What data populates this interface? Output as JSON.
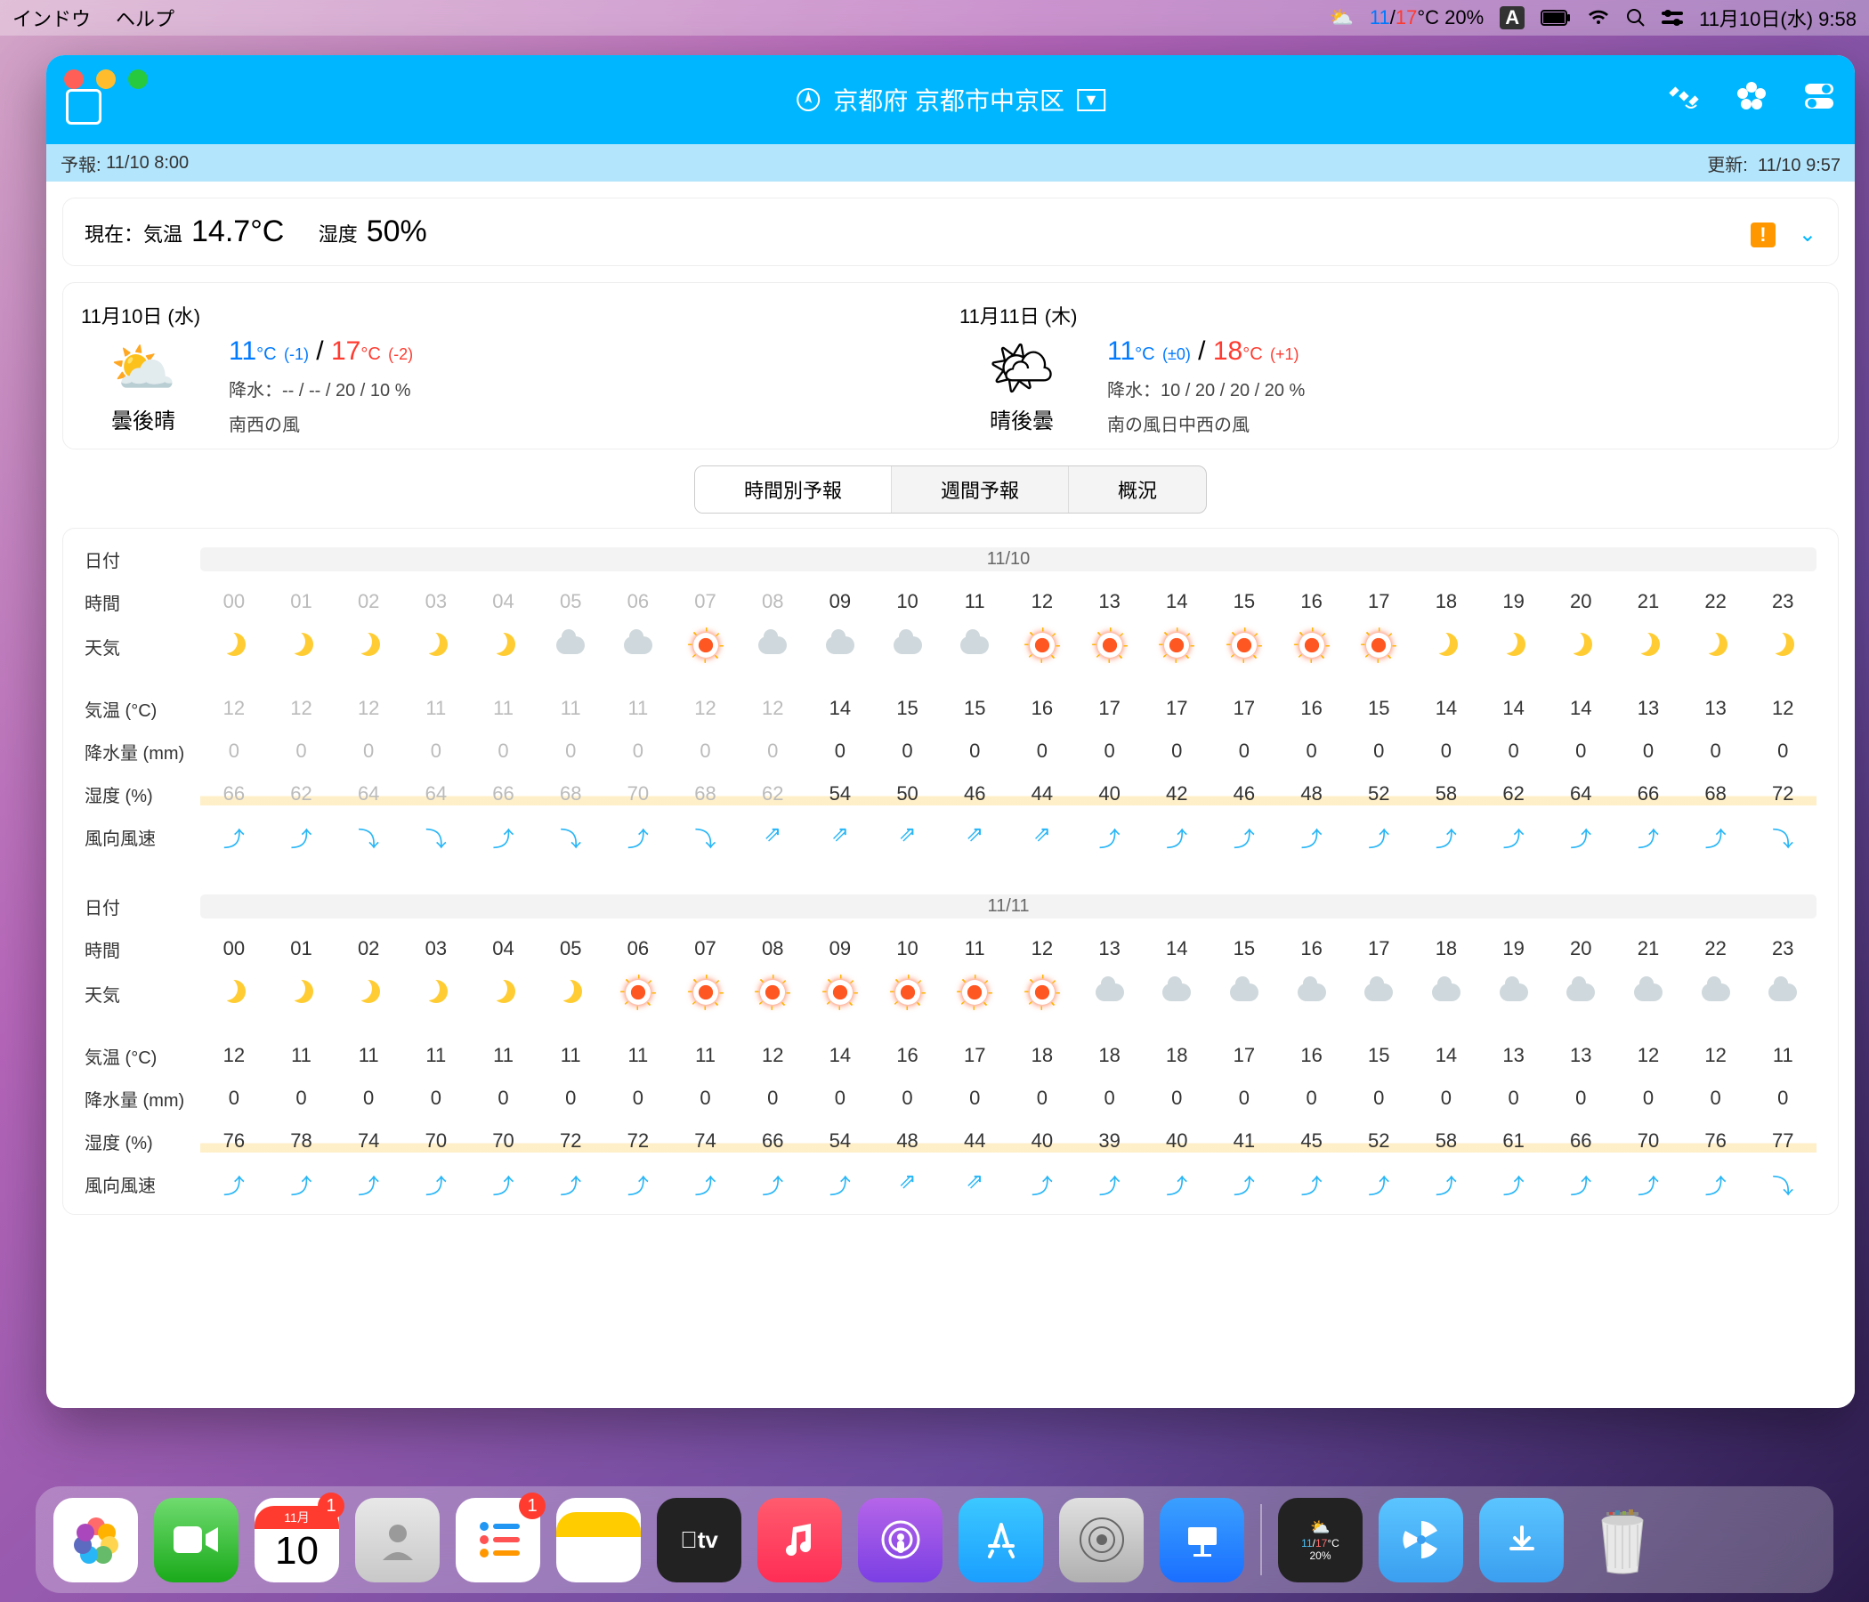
{
  "menubar": {
    "left": [
      "インドウ",
      "ヘルプ"
    ],
    "weather": {
      "lo": "11",
      "hi": "17",
      "unit": "°C",
      "pop": "20%"
    },
    "datetime": "11月10日(水)  9:58",
    "input_indicator": "A"
  },
  "titlebar": {
    "location": "京都府 京都市中京区"
  },
  "infobar": {
    "forecast_label": "予報:",
    "forecast_time": "11/10 8:00",
    "update_label": "更新:",
    "update_time": "11/10 9:57"
  },
  "now": {
    "label": "現在：気温",
    "temp": "14.7°C",
    "humidity_label": "湿度",
    "humidity": "50%"
  },
  "days": [
    {
      "title": "11月10日 (水)",
      "icon_text": "曇後晴",
      "lo": "11",
      "lo_unit": "°C",
      "lo_diff": "(-1)",
      "hi": "17",
      "hi_unit": "°C",
      "hi_diff": "(-2)",
      "precip_label": "降水：",
      "precip": "-- / -- / 20 / 10 %",
      "wind": "南西の風"
    },
    {
      "title": "11月11日 (木)",
      "icon_text": "晴後曇",
      "lo": "11",
      "lo_unit": "°C",
      "lo_diff": "(±0)",
      "hi": "18",
      "hi_unit": "°C",
      "hi_diff": "(+1)",
      "precip_label": "降水：",
      "precip": "10 / 20 / 20 / 20 %",
      "wind": "南の風日中西の風"
    }
  ],
  "tabs": {
    "hourly": "時間別予報",
    "weekly": "週間予報",
    "overview": "概況"
  },
  "labels": {
    "date": "日付",
    "time": "時間",
    "weather": "天気",
    "temp": "気温 (°C)",
    "precip": "降水量 (mm)",
    "humidity": "湿度 (%)",
    "wind": "風向風速"
  },
  "hourly": [
    {
      "date": "11/10",
      "hours": [
        "00",
        "01",
        "02",
        "03",
        "04",
        "05",
        "06",
        "07",
        "08",
        "09",
        "10",
        "11",
        "12",
        "13",
        "14",
        "15",
        "16",
        "17",
        "18",
        "19",
        "20",
        "21",
        "22",
        "23"
      ],
      "past": 9,
      "icons": [
        "moon",
        "moon",
        "moon",
        "moon",
        "moon",
        "cloud",
        "cloud",
        "sunred",
        "cloud",
        "cloud",
        "cloud",
        "cloud",
        "sunred",
        "sunred",
        "sunred",
        "sunred",
        "sunred",
        "sunred",
        "moon",
        "moon",
        "moon",
        "moon",
        "moon",
        "moon"
      ],
      "temp": [
        "12",
        "12",
        "12",
        "11",
        "11",
        "11",
        "11",
        "12",
        "12",
        "14",
        "15",
        "15",
        "16",
        "17",
        "17",
        "17",
        "16",
        "15",
        "14",
        "14",
        "14",
        "13",
        "13",
        "12"
      ],
      "precip": [
        "0",
        "0",
        "0",
        "0",
        "0",
        "0",
        "0",
        "0",
        "0",
        "0",
        "0",
        "0",
        "0",
        "0",
        "0",
        "0",
        "0",
        "0",
        "0",
        "0",
        "0",
        "0",
        "0",
        "0"
      ],
      "humidity": [
        "66",
        "62",
        "64",
        "64",
        "66",
        "68",
        "70",
        "68",
        "62",
        "54",
        "50",
        "46",
        "44",
        "40",
        "42",
        "46",
        "48",
        "52",
        "58",
        "62",
        "64",
        "66",
        "68",
        "72"
      ],
      "wind": [
        "⤴",
        "⤴",
        "⤵",
        "⤵",
        "⤴",
        "⤵",
        "⤴",
        "⤵",
        "⇗",
        "⇗",
        "⇗",
        "⇗",
        "⇗",
        "⤴",
        "⤴",
        "⤴",
        "⤴",
        "⤴",
        "⤴",
        "⤴",
        "⤴",
        "⤴",
        "⤴",
        "⤵"
      ]
    },
    {
      "date": "11/11",
      "hours": [
        "00",
        "01",
        "02",
        "03",
        "04",
        "05",
        "06",
        "07",
        "08",
        "09",
        "10",
        "11",
        "12",
        "13",
        "14",
        "15",
        "16",
        "17",
        "18",
        "19",
        "20",
        "21",
        "22",
        "23"
      ],
      "past": 0,
      "icons": [
        "moon",
        "moon",
        "moon",
        "moon",
        "moon",
        "moon",
        "sunred",
        "sunred",
        "sunred",
        "sunred",
        "sunred",
        "sunred",
        "sunred",
        "cloud",
        "cloud",
        "cloud",
        "cloud",
        "cloud",
        "cloud",
        "cloud",
        "cloud",
        "cloud",
        "cloud",
        "cloud"
      ],
      "temp": [
        "12",
        "11",
        "11",
        "11",
        "11",
        "11",
        "11",
        "11",
        "12",
        "14",
        "16",
        "17",
        "18",
        "18",
        "17",
        "16",
        "15",
        "14",
        "13",
        "13",
        "12",
        "12",
        "11"
      ],
      "temp24": [
        "12",
        "11",
        "11",
        "11",
        "11",
        "11",
        "11",
        "11",
        "12",
        "14",
        "16",
        "17",
        "18",
        "18",
        "18",
        "17",
        "16",
        "15",
        "14",
        "13",
        "13",
        "12",
        "12",
        "11"
      ],
      "precip": [
        "0",
        "0",
        "0",
        "0",
        "0",
        "0",
        "0",
        "0",
        "0",
        "0",
        "0",
        "0",
        "0",
        "0",
        "0",
        "0",
        "0",
        "0",
        "0",
        "0",
        "0",
        "0",
        "0",
        "0"
      ],
      "humidity": [
        "76",
        "78",
        "74",
        "70",
        "70",
        "72",
        "72",
        "74",
        "66",
        "54",
        "48",
        "44",
        "40",
        "39",
        "40",
        "41",
        "45",
        "52",
        "58",
        "61",
        "66",
        "70",
        "76",
        "77"
      ],
      "wind": [
        "⤴",
        "⤴",
        "⤴",
        "⤴",
        "⤴",
        "⤴",
        "⤴",
        "⤴",
        "⤴",
        "⤴",
        "⇗",
        "⇗",
        "⤴",
        "⤴",
        "⤴",
        "⤴",
        "⤴",
        "⤴",
        "⤴",
        "⤴",
        "⤴",
        "⤴",
        "⤴",
        "⤵"
      ]
    }
  ],
  "dock": {
    "cal_month": "11月",
    "cal_day": "10",
    "cal_badge": "1",
    "reminders_badge": "1",
    "widget_lo": "11",
    "widget_hi": "17",
    "widget_pop": "20%"
  }
}
